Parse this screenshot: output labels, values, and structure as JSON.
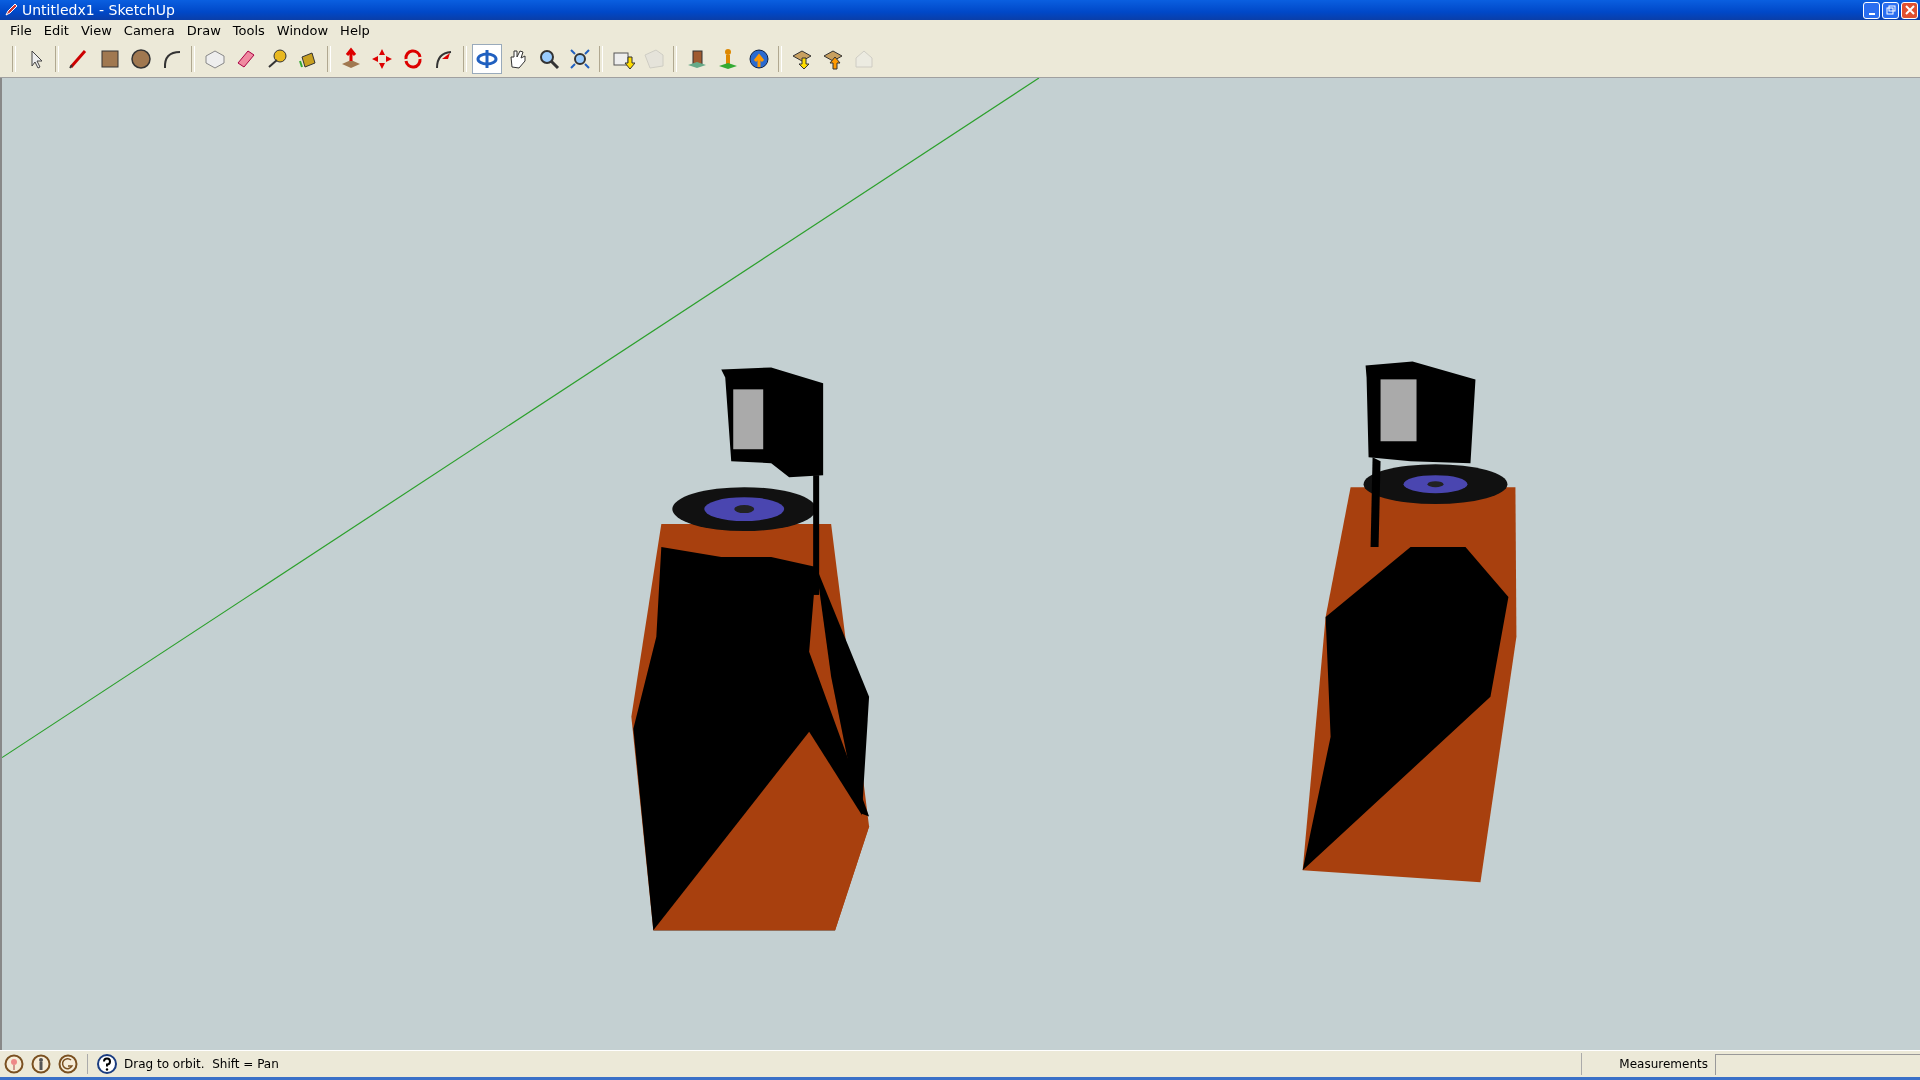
{
  "window": {
    "title": "Untitledx1 - SketchUp"
  },
  "menu": [
    {
      "label": "File"
    },
    {
      "label": "Edit"
    },
    {
      "label": "View"
    },
    {
      "label": "Camera"
    },
    {
      "label": "Draw"
    },
    {
      "label": "Tools"
    },
    {
      "label": "Window"
    },
    {
      "label": "Help"
    }
  ],
  "toolbar": {
    "groups": [
      {
        "tools": [
          {
            "kind": "select",
            "selected": false,
            "disabled": false
          }
        ]
      },
      {
        "tools": [
          {
            "kind": "line",
            "selected": false,
            "disabled": false
          },
          {
            "kind": "rectangle",
            "selected": false,
            "disabled": false
          },
          {
            "kind": "circle",
            "selected": false,
            "disabled": false
          },
          {
            "kind": "arc",
            "selected": false,
            "disabled": false
          }
        ]
      },
      {
        "tools": [
          {
            "kind": "component",
            "selected": false,
            "disabled": false
          },
          {
            "kind": "eraser",
            "selected": false,
            "disabled": false
          },
          {
            "kind": "tape",
            "selected": false,
            "disabled": false
          },
          {
            "kind": "paint",
            "selected": false,
            "disabled": false
          }
        ]
      },
      {
        "tools": [
          {
            "kind": "pushpull",
            "selected": false,
            "disabled": false
          },
          {
            "kind": "move",
            "selected": false,
            "disabled": false
          },
          {
            "kind": "rotate",
            "selected": false,
            "disabled": false
          },
          {
            "kind": "followme",
            "selected": false,
            "disabled": false
          }
        ]
      },
      {
        "tools": [
          {
            "kind": "orbit",
            "selected": true,
            "disabled": false
          },
          {
            "kind": "pan",
            "selected": false,
            "disabled": false
          },
          {
            "kind": "zoom",
            "selected": false,
            "disabled": false
          },
          {
            "kind": "extents",
            "selected": false,
            "disabled": false
          }
        ]
      },
      {
        "tools": [
          {
            "kind": "getmodels",
            "selected": false,
            "disabled": false
          },
          {
            "kind": "sharemodel",
            "selected": false,
            "disabled": true
          }
        ]
      },
      {
        "tools": [
          {
            "kind": "building",
            "selected": false,
            "disabled": false
          },
          {
            "kind": "location",
            "selected": false,
            "disabled": false
          },
          {
            "kind": "earth",
            "selected": false,
            "disabled": false
          }
        ]
      },
      {
        "tools": [
          {
            "kind": "getcomponent",
            "selected": false,
            "disabled": false
          },
          {
            "kind": "sharecomponent",
            "selected": false,
            "disabled": false
          },
          {
            "kind": "house",
            "selected": false,
            "disabled": true
          }
        ]
      }
    ]
  },
  "status_bar": {
    "icons": [
      {
        "kind": "geo"
      },
      {
        "kind": "person"
      },
      {
        "kind": "credit"
      }
    ],
    "hint": "Drag to orbit.  Shift = Pan",
    "measurements_label": "Measurements"
  }
}
